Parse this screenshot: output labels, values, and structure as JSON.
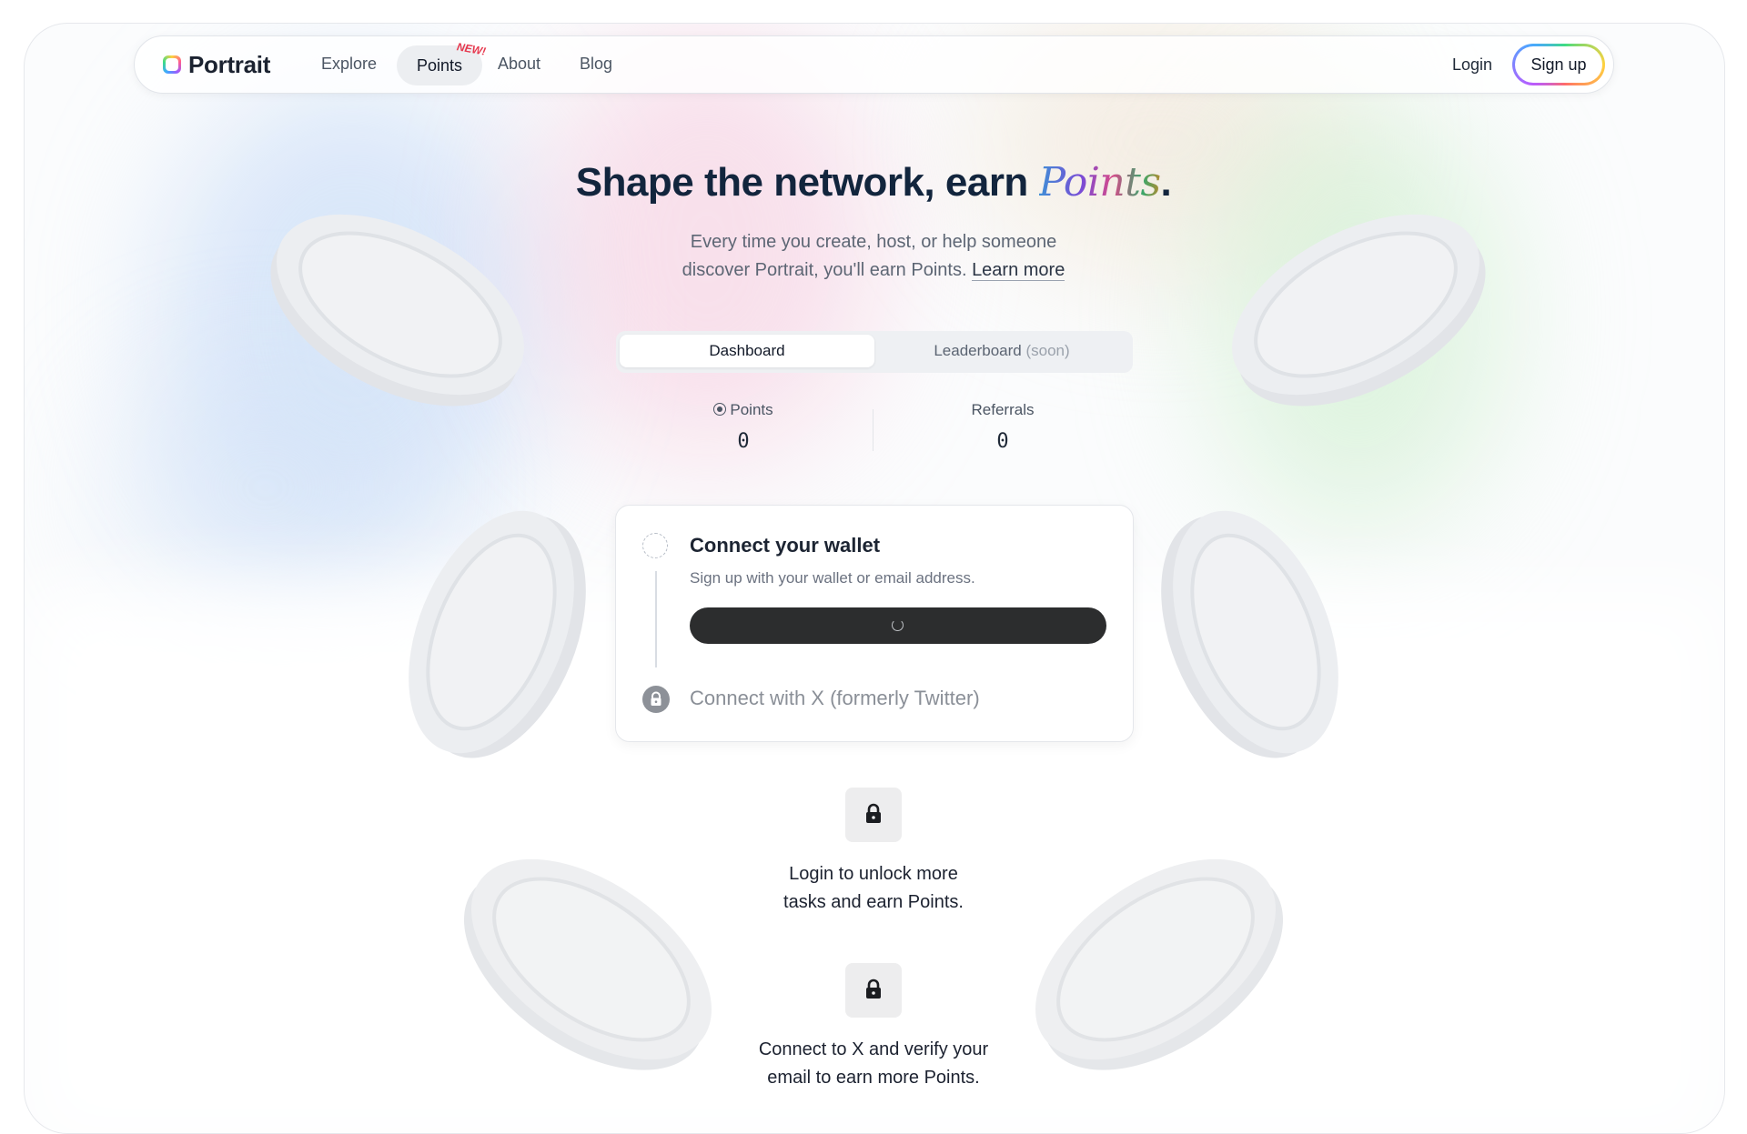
{
  "nav": {
    "logo": "Portrait",
    "items": [
      {
        "label": "Explore"
      },
      {
        "label": "Points",
        "badge": "NEW!",
        "active": true
      },
      {
        "label": "About"
      },
      {
        "label": "Blog"
      }
    ],
    "login": "Login",
    "signup": "Sign up"
  },
  "hero": {
    "headline_prefix": "Shape the network, earn ",
    "headline_highlight": "Points",
    "headline_suffix": ".",
    "sub_line1": "Every time you create, host, or help someone",
    "sub_line2": "discover Portrait, you'll earn Points.",
    "learn_more": "Learn more"
  },
  "tabs": {
    "dashboard": "Dashboard",
    "leaderboard": "Leaderboard",
    "leaderboard_note": "(soon)"
  },
  "stats": {
    "points_label": "Points",
    "points_value": "0",
    "referrals_label": "Referrals",
    "referrals_value": "0"
  },
  "steps": {
    "wallet_title": "Connect your wallet",
    "wallet_desc": "Sign up with your wallet or email address.",
    "twitter_title": "Connect with X (formerly Twitter)"
  },
  "locked": [
    {
      "line1": "Login to unlock more",
      "line2": "tasks and earn Points."
    },
    {
      "line1": "Connect to X and verify your",
      "line2": "email to earn more Points."
    }
  ],
  "colors": {
    "heading": "#12253d",
    "button_dark": "#2c2d2e",
    "badge_red": "#e6384e"
  }
}
